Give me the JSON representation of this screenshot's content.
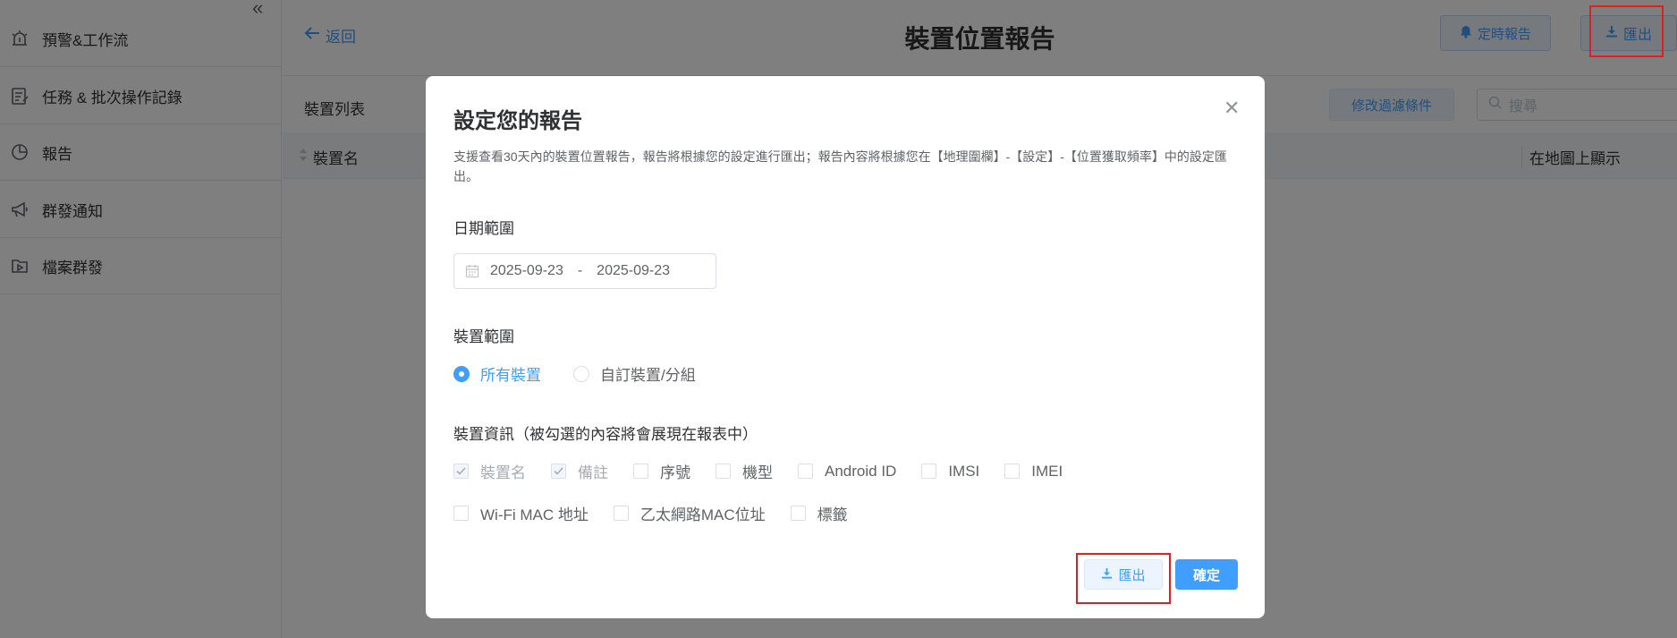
{
  "sidebar": {
    "items": [
      {
        "label": "預警&工作流",
        "icon": "alarm-icon"
      },
      {
        "label": "任務 & 批次操作記錄",
        "icon": "task-log-icon"
      },
      {
        "label": "報告",
        "icon": "pie-chart-icon"
      },
      {
        "label": "群發通知",
        "icon": "megaphone-icon"
      },
      {
        "label": "檔案群發",
        "icon": "file-send-icon"
      }
    ]
  },
  "header": {
    "back_label": "返回",
    "title": "裝置位置報告",
    "schedule_label": "定時報告",
    "export_label": "匯出"
  },
  "toolbar": {
    "list_title": "裝置列表",
    "filter_label": "修改過濾條件",
    "search_placeholder": "搜尋"
  },
  "table": {
    "columns": [
      "裝置名",
      "在地圖上顯示"
    ]
  },
  "modal": {
    "title": "設定您的報告",
    "description": "支援查看30天內的裝置位置報告，報告將根據您的設定進行匯出；報告內容將根據您在【地理圍欄】-【設定】-【位置獲取頻率】中的設定匯出。",
    "date_section": "日期範圍",
    "date_start": "2025-09-23",
    "date_sep": "-",
    "date_end": "2025-09-23",
    "device_section": "裝置範圍",
    "radio_all": "所有裝置",
    "radio_custom": "自訂裝置/分組",
    "info_section": "裝置資訊（被勾選的內容將會展現在報表中）",
    "checks_row1": [
      "裝置名",
      "備註",
      "序號",
      "機型",
      "Android ID",
      "IMSI",
      "IMEI"
    ],
    "checks_row2": [
      "Wi-Fi MAC 地址",
      "乙太網路MAC位址",
      "標籤"
    ],
    "export_label": "匯出",
    "confirm_label": "確定"
  },
  "colors": {
    "accent": "#409eff",
    "highlight": "#e02020"
  }
}
